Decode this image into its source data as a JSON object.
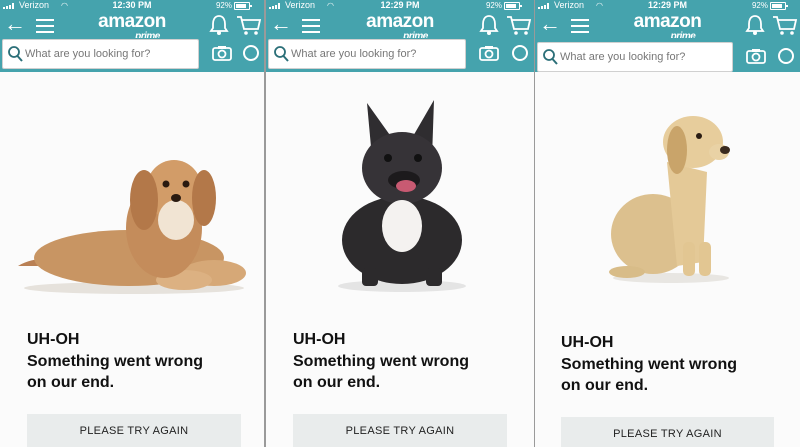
{
  "screens": [
    {
      "status": {
        "carrier": "Verizon",
        "time": "12:30 PM",
        "battery": "92%"
      },
      "logo": {
        "word": "amazon",
        "sub": "prime"
      },
      "search": {
        "placeholder": "What are you looking for?"
      },
      "error": {
        "title": "UH-OH",
        "message_line1": "Something went wrong",
        "message_line2": "on our end."
      },
      "button": {
        "label": "PLEASE TRY AGAIN"
      },
      "dog_description": "cavapoo-dog-photo"
    },
    {
      "status": {
        "carrier": "Verizon",
        "time": "12:29 PM",
        "battery": "92%"
      },
      "logo": {
        "word": "amazon",
        "sub": "prime"
      },
      "search": {
        "placeholder": "What are you looking for?"
      },
      "error": {
        "title": "UH-OH",
        "message_line1": "Something went wrong",
        "message_line2": "on our end."
      },
      "button": {
        "label": "PLEASE TRY AGAIN"
      },
      "dog_description": "french-bulldog-photo"
    },
    {
      "status": {
        "carrier": "Verizon",
        "time": "12:29 PM",
        "battery": "92%"
      },
      "logo": {
        "word": "amazon",
        "sub": "prime"
      },
      "search": {
        "placeholder": "What are you looking for?"
      },
      "error": {
        "title": "UH-OH",
        "message_line1": "Something went wrong",
        "message_line2": "on our end."
      },
      "button": {
        "label": "PLEASE TRY AGAIN"
      },
      "dog_description": "labrador-dog-photo"
    }
  ],
  "colors": {
    "header": "#45a3ad",
    "page": "#fbfbfb",
    "button": "#e9ecec",
    "divider": "#9a9a9a"
  }
}
